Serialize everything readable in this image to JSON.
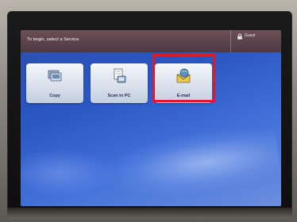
{
  "header": {
    "message": "To begin, select a Service.",
    "guest_label": "Guest"
  },
  "services": [
    {
      "label": "Copy",
      "icon": "copy-icon"
    },
    {
      "label": "Scan to PC",
      "icon": "scan-to-pc-icon"
    },
    {
      "label": "E-mail",
      "icon": "email-icon"
    }
  ],
  "colors": {
    "screen_blue": "#2a56c4",
    "header": "#5a424b",
    "tile": "#e3e9f1",
    "highlight": "#e0192a"
  }
}
